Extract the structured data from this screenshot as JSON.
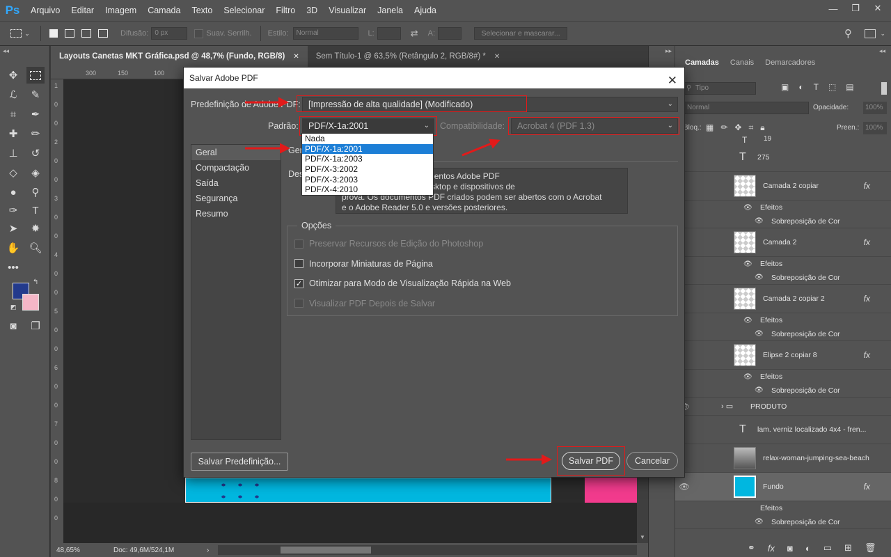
{
  "app": {
    "logo": "Ps"
  },
  "menu": [
    "Arquivo",
    "Editar",
    "Imagem",
    "Camada",
    "Texto",
    "Selecionar",
    "Filtro",
    "3D",
    "Visualizar",
    "Janela",
    "Ajuda"
  ],
  "window_controls": [
    "—",
    "❐",
    "✕"
  ],
  "options_bar": {
    "difusao_label": "Difusão:",
    "difusao_value": "0 px",
    "suav_label": "Suav. Serrilh.",
    "estilo_label": "Estilo:",
    "estilo_value": "Normal",
    "l_label": "L:",
    "a_label": "A:",
    "select_mask": "Selecionar e mascarar..."
  },
  "tabs": [
    {
      "label": "Layouts Canetas MKT Gráfica.psd @ 48,7% (Fundo, RGB/8)",
      "close": "✕"
    },
    {
      "label": "Sem Título-1 @ 63,5% (Retângulo 2, RGB/8#) *",
      "close": "✕"
    }
  ],
  "ruler": {
    "top": [
      "300",
      "150",
      "100"
    ],
    "left": [
      "1",
      "0",
      "0",
      "2",
      "0",
      "0",
      "3",
      "0",
      "0",
      "4",
      "0",
      "0",
      "5",
      "0",
      "0",
      "6",
      "0",
      "0",
      "7",
      "0",
      "0",
      "8",
      "0",
      "0"
    ]
  },
  "status": {
    "zoom": "48,65%",
    "doc": "Doc: 49,6M/524,1M",
    "arrow": "›"
  },
  "panel": {
    "tabs": [
      "Camadas",
      "Canais",
      "Demarcadores"
    ],
    "filter_label": "Tipo",
    "blend": "Normal",
    "opacity_label": "Opacidade:",
    "opacity_value": "100%",
    "lock_label": "Bloq.:",
    "fill_label": "Preen.:",
    "fill_value": "100%"
  },
  "layers": [
    {
      "name": "275",
      "kind": "text"
    },
    {
      "name": "Camada 2 copiar",
      "kind": "layer",
      "fx": "fx"
    },
    {
      "name": "Efeitos",
      "kind": "effect"
    },
    {
      "name": "Sobreposição de Cor",
      "kind": "subeffect"
    },
    {
      "name": "Camada 2",
      "kind": "layer",
      "fx": "fx"
    },
    {
      "name": "Efeitos",
      "kind": "effect"
    },
    {
      "name": "Sobreposição de Cor",
      "kind": "subeffect"
    },
    {
      "name": "Camada 2 copiar 2",
      "kind": "layer",
      "fx": "fx"
    },
    {
      "name": "Efeitos",
      "kind": "effect"
    },
    {
      "name": "Sobreposição de Cor",
      "kind": "subeffect"
    },
    {
      "name": "Elipse 2 copiar 8",
      "kind": "layer",
      "fx": "fx"
    },
    {
      "name": "Efeitos",
      "kind": "effect"
    },
    {
      "name": "Sobreposição de Cor",
      "kind": "subeffect"
    },
    {
      "name": "PRODUTO",
      "kind": "group"
    },
    {
      "name": "lam. verniz localizado 4x4 - fren...",
      "kind": "text"
    },
    {
      "name": "relax-woman-jumping-sea-beach",
      "kind": "photo"
    },
    {
      "name": "Fundo",
      "kind": "fundo",
      "fx": "fx"
    },
    {
      "name": "Efeitos",
      "kind": "effect"
    },
    {
      "name": "Sobreposição de Cor",
      "kind": "subeffect"
    }
  ],
  "dialog": {
    "title": "Salvar Adobe PDF",
    "close": "✕",
    "preset_label": "Predefinição de Adobe PDF:",
    "preset_value": "[Impressão de alta qualidade] (Modificado)",
    "standard_label": "Padrão:",
    "standard_value": "PDF/X-1a:2001",
    "compat_label": "Compatibilidade:",
    "compat_value": "Acrobat 4 (PDF 1.3)",
    "sections": [
      "Geral",
      "Compactação",
      "Saída",
      "Segurança",
      "Resumo"
    ],
    "section_heading": "Geral",
    "desc_label": "Des",
    "desc_text": "s de forma a criar documentos Adobe PDF\nlade em impressoras desktop e dispositivos de\nprova. Os documentos PDF criados podem ser abertos com o Acrobat\ne o Adobe Reader 5.0 e versões posteriores.",
    "options_title": "Opções",
    "options": [
      {
        "label": "Preservar Recursos de Edição do Photoshop",
        "checked": false,
        "disabled": true
      },
      {
        "label": "Incorporar Miniaturas de Página",
        "checked": false,
        "disabled": false
      },
      {
        "label": "Otimizar para Modo de Visualização Rápida na Web",
        "checked": true,
        "disabled": false
      },
      {
        "label": "Visualizar PDF Depois de Salvar",
        "checked": false,
        "disabled": true
      }
    ],
    "save_preset_button": "Salvar Predefinição...",
    "save_pdf_button": "Salvar PDF",
    "cancel_button": "Cancelar",
    "dropdown_options": [
      "Nada",
      "PDF/X-1a:2001",
      "PDF/X-1a:2003",
      "PDF/X-3:2002",
      "PDF/X-3:2003",
      "PDF/X-4:2010"
    ],
    "dropdown_selected_index": 1
  },
  "colors": {
    "annotation_red": "#e21a1a",
    "selection_blue": "#1c7ed6",
    "foreground": "#233a8c",
    "background": "#f4b6c7",
    "cyan": "#00b7e0",
    "pink": "#f23b8d"
  }
}
